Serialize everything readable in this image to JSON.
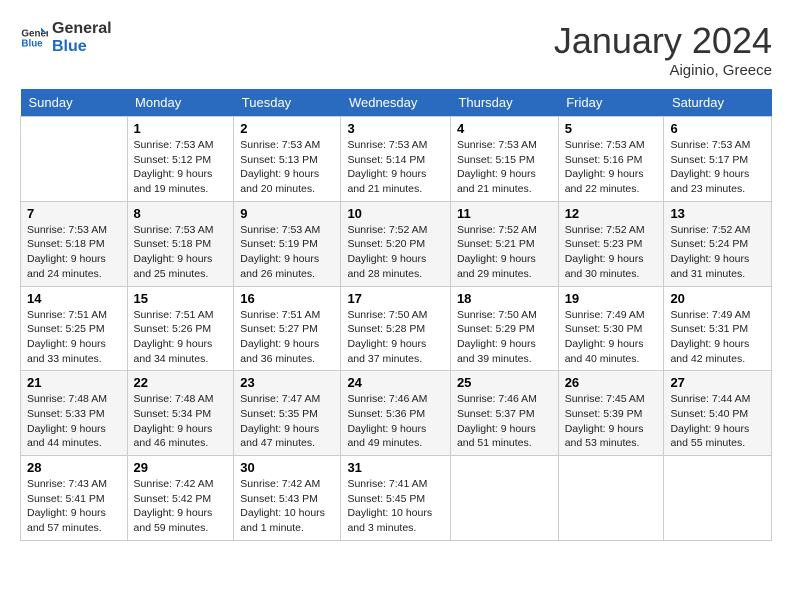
{
  "logo": {
    "line1": "General",
    "line2": "Blue"
  },
  "title": "January 2024",
  "subtitle": "Aiginio, Greece",
  "days_header": [
    "Sunday",
    "Monday",
    "Tuesday",
    "Wednesday",
    "Thursday",
    "Friday",
    "Saturday"
  ],
  "weeks": [
    [
      {
        "day": "",
        "info": ""
      },
      {
        "day": "1",
        "info": "Sunrise: 7:53 AM\nSunset: 5:12 PM\nDaylight: 9 hours\nand 19 minutes."
      },
      {
        "day": "2",
        "info": "Sunrise: 7:53 AM\nSunset: 5:13 PM\nDaylight: 9 hours\nand 20 minutes."
      },
      {
        "day": "3",
        "info": "Sunrise: 7:53 AM\nSunset: 5:14 PM\nDaylight: 9 hours\nand 21 minutes."
      },
      {
        "day": "4",
        "info": "Sunrise: 7:53 AM\nSunset: 5:15 PM\nDaylight: 9 hours\nand 21 minutes."
      },
      {
        "day": "5",
        "info": "Sunrise: 7:53 AM\nSunset: 5:16 PM\nDaylight: 9 hours\nand 22 minutes."
      },
      {
        "day": "6",
        "info": "Sunrise: 7:53 AM\nSunset: 5:17 PM\nDaylight: 9 hours\nand 23 minutes."
      }
    ],
    [
      {
        "day": "7",
        "info": "Sunrise: 7:53 AM\nSunset: 5:18 PM\nDaylight: 9 hours\nand 24 minutes."
      },
      {
        "day": "8",
        "info": "Sunrise: 7:53 AM\nSunset: 5:18 PM\nDaylight: 9 hours\nand 25 minutes."
      },
      {
        "day": "9",
        "info": "Sunrise: 7:53 AM\nSunset: 5:19 PM\nDaylight: 9 hours\nand 26 minutes."
      },
      {
        "day": "10",
        "info": "Sunrise: 7:52 AM\nSunset: 5:20 PM\nDaylight: 9 hours\nand 28 minutes."
      },
      {
        "day": "11",
        "info": "Sunrise: 7:52 AM\nSunset: 5:21 PM\nDaylight: 9 hours\nand 29 minutes."
      },
      {
        "day": "12",
        "info": "Sunrise: 7:52 AM\nSunset: 5:23 PM\nDaylight: 9 hours\nand 30 minutes."
      },
      {
        "day": "13",
        "info": "Sunrise: 7:52 AM\nSunset: 5:24 PM\nDaylight: 9 hours\nand 31 minutes."
      }
    ],
    [
      {
        "day": "14",
        "info": "Sunrise: 7:51 AM\nSunset: 5:25 PM\nDaylight: 9 hours\nand 33 minutes."
      },
      {
        "day": "15",
        "info": "Sunrise: 7:51 AM\nSunset: 5:26 PM\nDaylight: 9 hours\nand 34 minutes."
      },
      {
        "day": "16",
        "info": "Sunrise: 7:51 AM\nSunset: 5:27 PM\nDaylight: 9 hours\nand 36 minutes."
      },
      {
        "day": "17",
        "info": "Sunrise: 7:50 AM\nSunset: 5:28 PM\nDaylight: 9 hours\nand 37 minutes."
      },
      {
        "day": "18",
        "info": "Sunrise: 7:50 AM\nSunset: 5:29 PM\nDaylight: 9 hours\nand 39 minutes."
      },
      {
        "day": "19",
        "info": "Sunrise: 7:49 AM\nSunset: 5:30 PM\nDaylight: 9 hours\nand 40 minutes."
      },
      {
        "day": "20",
        "info": "Sunrise: 7:49 AM\nSunset: 5:31 PM\nDaylight: 9 hours\nand 42 minutes."
      }
    ],
    [
      {
        "day": "21",
        "info": "Sunrise: 7:48 AM\nSunset: 5:33 PM\nDaylight: 9 hours\nand 44 minutes."
      },
      {
        "day": "22",
        "info": "Sunrise: 7:48 AM\nSunset: 5:34 PM\nDaylight: 9 hours\nand 46 minutes."
      },
      {
        "day": "23",
        "info": "Sunrise: 7:47 AM\nSunset: 5:35 PM\nDaylight: 9 hours\nand 47 minutes."
      },
      {
        "day": "24",
        "info": "Sunrise: 7:46 AM\nSunset: 5:36 PM\nDaylight: 9 hours\nand 49 minutes."
      },
      {
        "day": "25",
        "info": "Sunrise: 7:46 AM\nSunset: 5:37 PM\nDaylight: 9 hours\nand 51 minutes."
      },
      {
        "day": "26",
        "info": "Sunrise: 7:45 AM\nSunset: 5:39 PM\nDaylight: 9 hours\nand 53 minutes."
      },
      {
        "day": "27",
        "info": "Sunrise: 7:44 AM\nSunset: 5:40 PM\nDaylight: 9 hours\nand 55 minutes."
      }
    ],
    [
      {
        "day": "28",
        "info": "Sunrise: 7:43 AM\nSunset: 5:41 PM\nDaylight: 9 hours\nand 57 minutes."
      },
      {
        "day": "29",
        "info": "Sunrise: 7:42 AM\nSunset: 5:42 PM\nDaylight: 9 hours\nand 59 minutes."
      },
      {
        "day": "30",
        "info": "Sunrise: 7:42 AM\nSunset: 5:43 PM\nDaylight: 10 hours\nand 1 minute."
      },
      {
        "day": "31",
        "info": "Sunrise: 7:41 AM\nSunset: 5:45 PM\nDaylight: 10 hours\nand 3 minutes."
      },
      {
        "day": "",
        "info": ""
      },
      {
        "day": "",
        "info": ""
      },
      {
        "day": "",
        "info": ""
      }
    ]
  ]
}
